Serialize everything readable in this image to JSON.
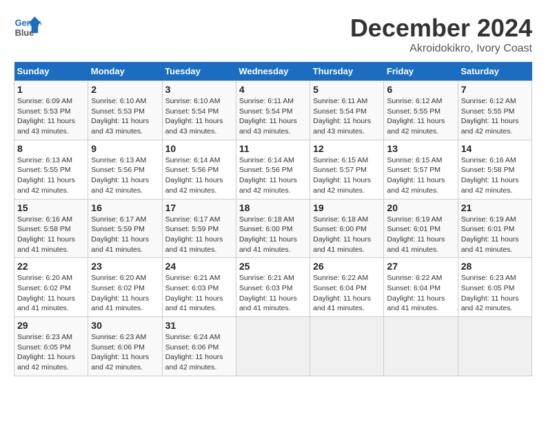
{
  "header": {
    "logo_line1": "General",
    "logo_line2": "Blue",
    "month_year": "December 2024",
    "location": "Akroidokikro, Ivory Coast"
  },
  "days_of_week": [
    "Sunday",
    "Monday",
    "Tuesday",
    "Wednesday",
    "Thursday",
    "Friday",
    "Saturday"
  ],
  "weeks": [
    [
      {
        "day": "1",
        "detail": "Sunrise: 6:09 AM\nSunset: 5:53 PM\nDaylight: 11 hours\nand 43 minutes."
      },
      {
        "day": "2",
        "detail": "Sunrise: 6:10 AM\nSunset: 5:53 PM\nDaylight: 11 hours\nand 43 minutes."
      },
      {
        "day": "3",
        "detail": "Sunrise: 6:10 AM\nSunset: 5:54 PM\nDaylight: 11 hours\nand 43 minutes."
      },
      {
        "day": "4",
        "detail": "Sunrise: 6:11 AM\nSunset: 5:54 PM\nDaylight: 11 hours\nand 43 minutes."
      },
      {
        "day": "5",
        "detail": "Sunrise: 6:11 AM\nSunset: 5:54 PM\nDaylight: 11 hours\nand 43 minutes."
      },
      {
        "day": "6",
        "detail": "Sunrise: 6:12 AM\nSunset: 5:55 PM\nDaylight: 11 hours\nand 42 minutes."
      },
      {
        "day": "7",
        "detail": "Sunrise: 6:12 AM\nSunset: 5:55 PM\nDaylight: 11 hours\nand 42 minutes."
      }
    ],
    [
      {
        "day": "8",
        "detail": "Sunrise: 6:13 AM\nSunset: 5:55 PM\nDaylight: 11 hours\nand 42 minutes."
      },
      {
        "day": "9",
        "detail": "Sunrise: 6:13 AM\nSunset: 5:56 PM\nDaylight: 11 hours\nand 42 minutes."
      },
      {
        "day": "10",
        "detail": "Sunrise: 6:14 AM\nSunset: 5:56 PM\nDaylight: 11 hours\nand 42 minutes."
      },
      {
        "day": "11",
        "detail": "Sunrise: 6:14 AM\nSunset: 5:56 PM\nDaylight: 11 hours\nand 42 minutes."
      },
      {
        "day": "12",
        "detail": "Sunrise: 6:15 AM\nSunset: 5:57 PM\nDaylight: 11 hours\nand 42 minutes."
      },
      {
        "day": "13",
        "detail": "Sunrise: 6:15 AM\nSunset: 5:57 PM\nDaylight: 11 hours\nand 42 minutes."
      },
      {
        "day": "14",
        "detail": "Sunrise: 6:16 AM\nSunset: 5:58 PM\nDaylight: 11 hours\nand 42 minutes."
      }
    ],
    [
      {
        "day": "15",
        "detail": "Sunrise: 6:16 AM\nSunset: 5:58 PM\nDaylight: 11 hours\nand 41 minutes."
      },
      {
        "day": "16",
        "detail": "Sunrise: 6:17 AM\nSunset: 5:59 PM\nDaylight: 11 hours\nand 41 minutes."
      },
      {
        "day": "17",
        "detail": "Sunrise: 6:17 AM\nSunset: 5:59 PM\nDaylight: 11 hours\nand 41 minutes."
      },
      {
        "day": "18",
        "detail": "Sunrise: 6:18 AM\nSunset: 6:00 PM\nDaylight: 11 hours\nand 41 minutes."
      },
      {
        "day": "19",
        "detail": "Sunrise: 6:18 AM\nSunset: 6:00 PM\nDaylight: 11 hours\nand 41 minutes."
      },
      {
        "day": "20",
        "detail": "Sunrise: 6:19 AM\nSunset: 6:01 PM\nDaylight: 11 hours\nand 41 minutes."
      },
      {
        "day": "21",
        "detail": "Sunrise: 6:19 AM\nSunset: 6:01 PM\nDaylight: 11 hours\nand 41 minutes."
      }
    ],
    [
      {
        "day": "22",
        "detail": "Sunrise: 6:20 AM\nSunset: 6:02 PM\nDaylight: 11 hours\nand 41 minutes."
      },
      {
        "day": "23",
        "detail": "Sunrise: 6:20 AM\nSunset: 6:02 PM\nDaylight: 11 hours\nand 41 minutes."
      },
      {
        "day": "24",
        "detail": "Sunrise: 6:21 AM\nSunset: 6:03 PM\nDaylight: 11 hours\nand 41 minutes."
      },
      {
        "day": "25",
        "detail": "Sunrise: 6:21 AM\nSunset: 6:03 PM\nDaylight: 11 hours\nand 41 minutes."
      },
      {
        "day": "26",
        "detail": "Sunrise: 6:22 AM\nSunset: 6:04 PM\nDaylight: 11 hours\nand 41 minutes."
      },
      {
        "day": "27",
        "detail": "Sunrise: 6:22 AM\nSunset: 6:04 PM\nDaylight: 11 hours\nand 41 minutes."
      },
      {
        "day": "28",
        "detail": "Sunrise: 6:23 AM\nSunset: 6:05 PM\nDaylight: 11 hours\nand 42 minutes."
      }
    ],
    [
      {
        "day": "29",
        "detail": "Sunrise: 6:23 AM\nSunset: 6:05 PM\nDaylight: 11 hours\nand 42 minutes."
      },
      {
        "day": "30",
        "detail": "Sunrise: 6:23 AM\nSunset: 6:06 PM\nDaylight: 11 hours\nand 42 minutes."
      },
      {
        "day": "31",
        "detail": "Sunrise: 6:24 AM\nSunset: 6:06 PM\nDaylight: 11 hours\nand 42 minutes."
      },
      {
        "day": "",
        "detail": ""
      },
      {
        "day": "",
        "detail": ""
      },
      {
        "day": "",
        "detail": ""
      },
      {
        "day": "",
        "detail": ""
      }
    ]
  ]
}
